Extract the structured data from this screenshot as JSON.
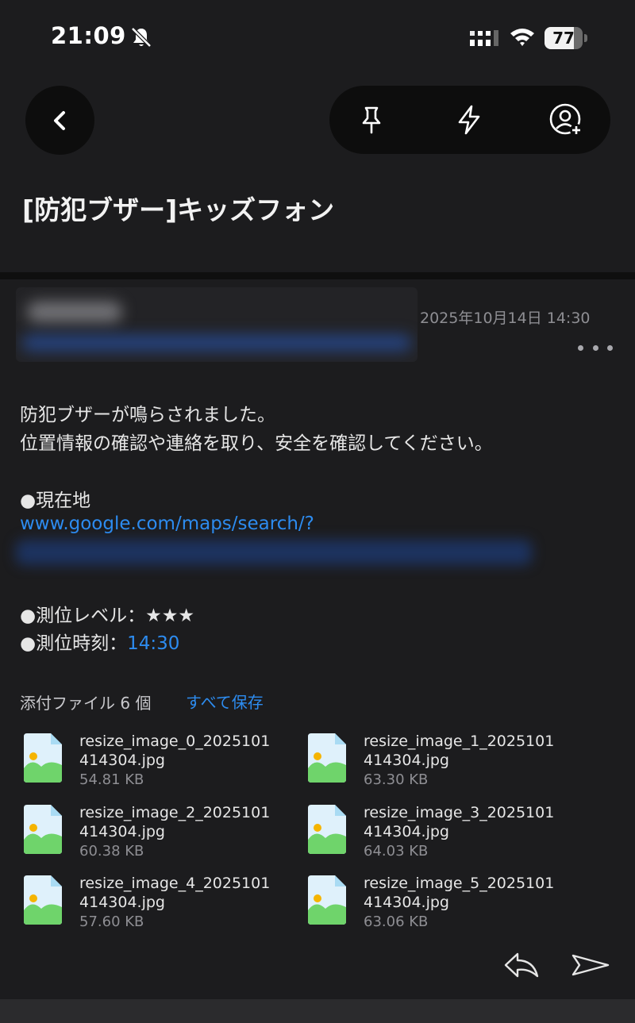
{
  "status_bar": {
    "time": "21:09",
    "battery_level": "77",
    "battery_fraction": 0.77,
    "icons": [
      "bell-slash-icon",
      "signal-icon",
      "wifi-icon",
      "battery-icon"
    ]
  },
  "toolbar": {
    "icons": [
      "back-chevron-icon",
      "pin-icon",
      "lightning-icon",
      "add-contact-icon"
    ]
  },
  "email": {
    "subject": "[防犯ブザー]キッズフォン",
    "date": "2025年10月14日 14:30",
    "body": {
      "line1": "防犯ブザーが鳴らされました。",
      "line2": "位置情報の確認や連絡を取り、安全を確認してください。",
      "location_label": "●現在地",
      "location_link": "www.google.com/maps/search/?",
      "level_label": "●測位レベル：",
      "level_stars": "★★★",
      "time_label": "●測位時刻：",
      "time_value": "14:30"
    }
  },
  "attachments": {
    "header": "添付ファイル 6 個",
    "save_all": "すべて保存",
    "files": [
      {
        "name": "resize_image_0_2025101414304.jpg",
        "size": "54.81 KB"
      },
      {
        "name": "resize_image_1_2025101414304.jpg",
        "size": "63.30 KB"
      },
      {
        "name": "resize_image_2_2025101414304.jpg",
        "size": "60.38 KB"
      },
      {
        "name": "resize_image_3_2025101414304.jpg",
        "size": "64.03 KB"
      },
      {
        "name": "resize_image_4_2025101414304.jpg",
        "size": "57.60 KB"
      },
      {
        "name": "resize_image_5_2025101414304.jpg",
        "size": "63.06 KB"
      }
    ]
  },
  "footer": {
    "icons": [
      "reply-icon",
      "forward-icon"
    ]
  },
  "colors": {
    "background": "#1c1c1e",
    "link": "#2d8cf0",
    "muted": "#8e8e93"
  }
}
